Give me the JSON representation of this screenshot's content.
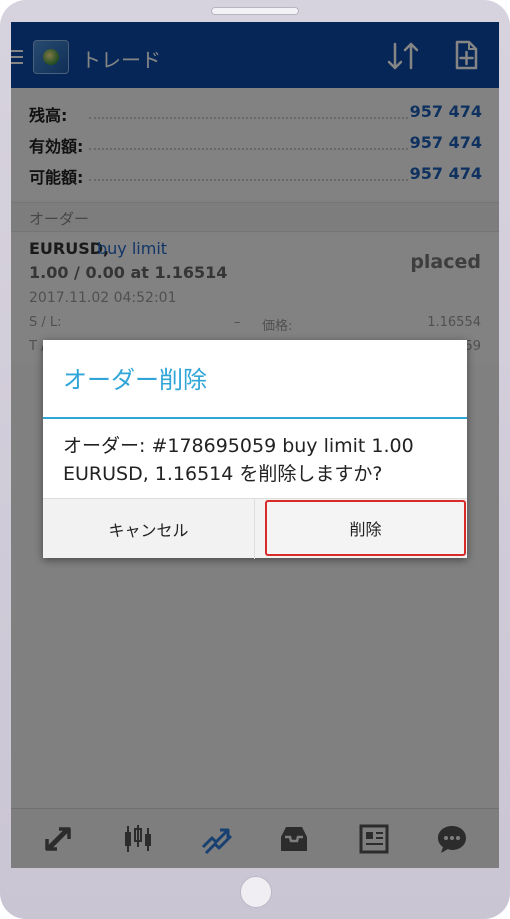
{
  "appbar": {
    "title": "トレード",
    "icons": [
      "menu-icon",
      "app-logo",
      "sort-icon",
      "new-document-icon"
    ]
  },
  "balance": [
    {
      "label": "残高:",
      "value": "957 474"
    },
    {
      "label": "有効額:",
      "value": "957 474"
    },
    {
      "label": "可能額:",
      "value": "957 474"
    }
  ],
  "orders_section": {
    "label": "オーダー"
  },
  "order": {
    "symbol": "EURUSD,",
    "type": "buy limit",
    "lots": "1.00 / 0.00 at 1.16514",
    "status": "placed",
    "time": "2017.11.02 04:52:01",
    "sl_label": "S / L:",
    "sl_value": "–",
    "price_label": "価格:",
    "price_value": "1.16554",
    "tp_label": "T /",
    "tp_value": "59"
  },
  "dialog": {
    "title": "オーダー削除",
    "message": "オーダー: #178695059 buy limit 1.00 EURUSD, 1.16514 を削除しますか?",
    "cancel_label": "キャンセル",
    "delete_label": "削除"
  },
  "colors": {
    "appbar": "#0a4aa6",
    "value_blue": "#1b5fb7",
    "dialog_accent": "#30a5d8",
    "highlight_red": "#d92a2a"
  }
}
